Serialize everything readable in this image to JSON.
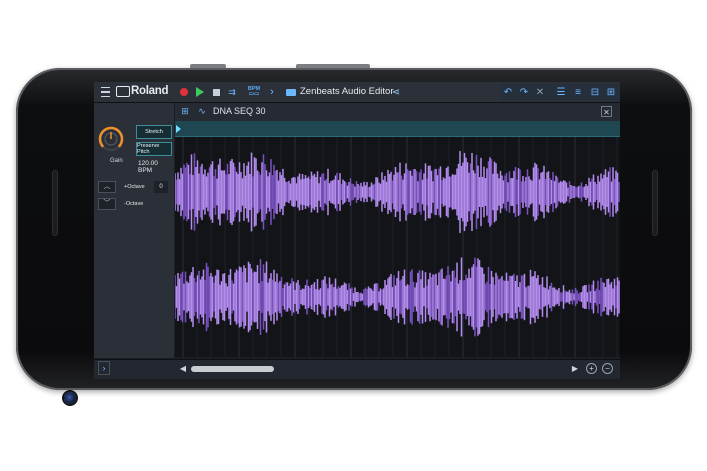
{
  "brand": "Roland",
  "title": "Zenbeats Audio Editor",
  "bpm_badge": "BPM\n120.0",
  "track": {
    "name": "DNA SEQ 30"
  },
  "controls": {
    "gain_label": "Gain",
    "stretch_label": "Stretch",
    "preserve_pitch_label": "Preserve Pitch",
    "tempo": "120.00 BPM",
    "octave_up_label": "+Octave",
    "octave_down_label": "-Octave",
    "octave_value": "0"
  },
  "icons": {
    "menu": "hamburger-icon",
    "record": "record-icon",
    "play": "play-icon",
    "stop": "stop-icon",
    "loop": "loop-icon",
    "bpm": "bpm-icon",
    "next": "chevron-right-icon",
    "folder": "folder-icon",
    "share": "share-icon",
    "undo": "undo-icon",
    "redo": "redo-icon",
    "tools": "tools-icon",
    "mixer": "mixer-icon",
    "list": "list-icon",
    "sliders": "sliders-icon",
    "grid": "grid-icon",
    "waveform": "waveform-icon",
    "close": "close-icon"
  },
  "colors": {
    "waveform": "#b58cf0",
    "waveform_dark": "#7a52c0",
    "accent": "#6db7ff",
    "record": "#e0313a",
    "play": "#3ec95a",
    "knob": "#f0922a",
    "ruler": "#1f4752"
  }
}
